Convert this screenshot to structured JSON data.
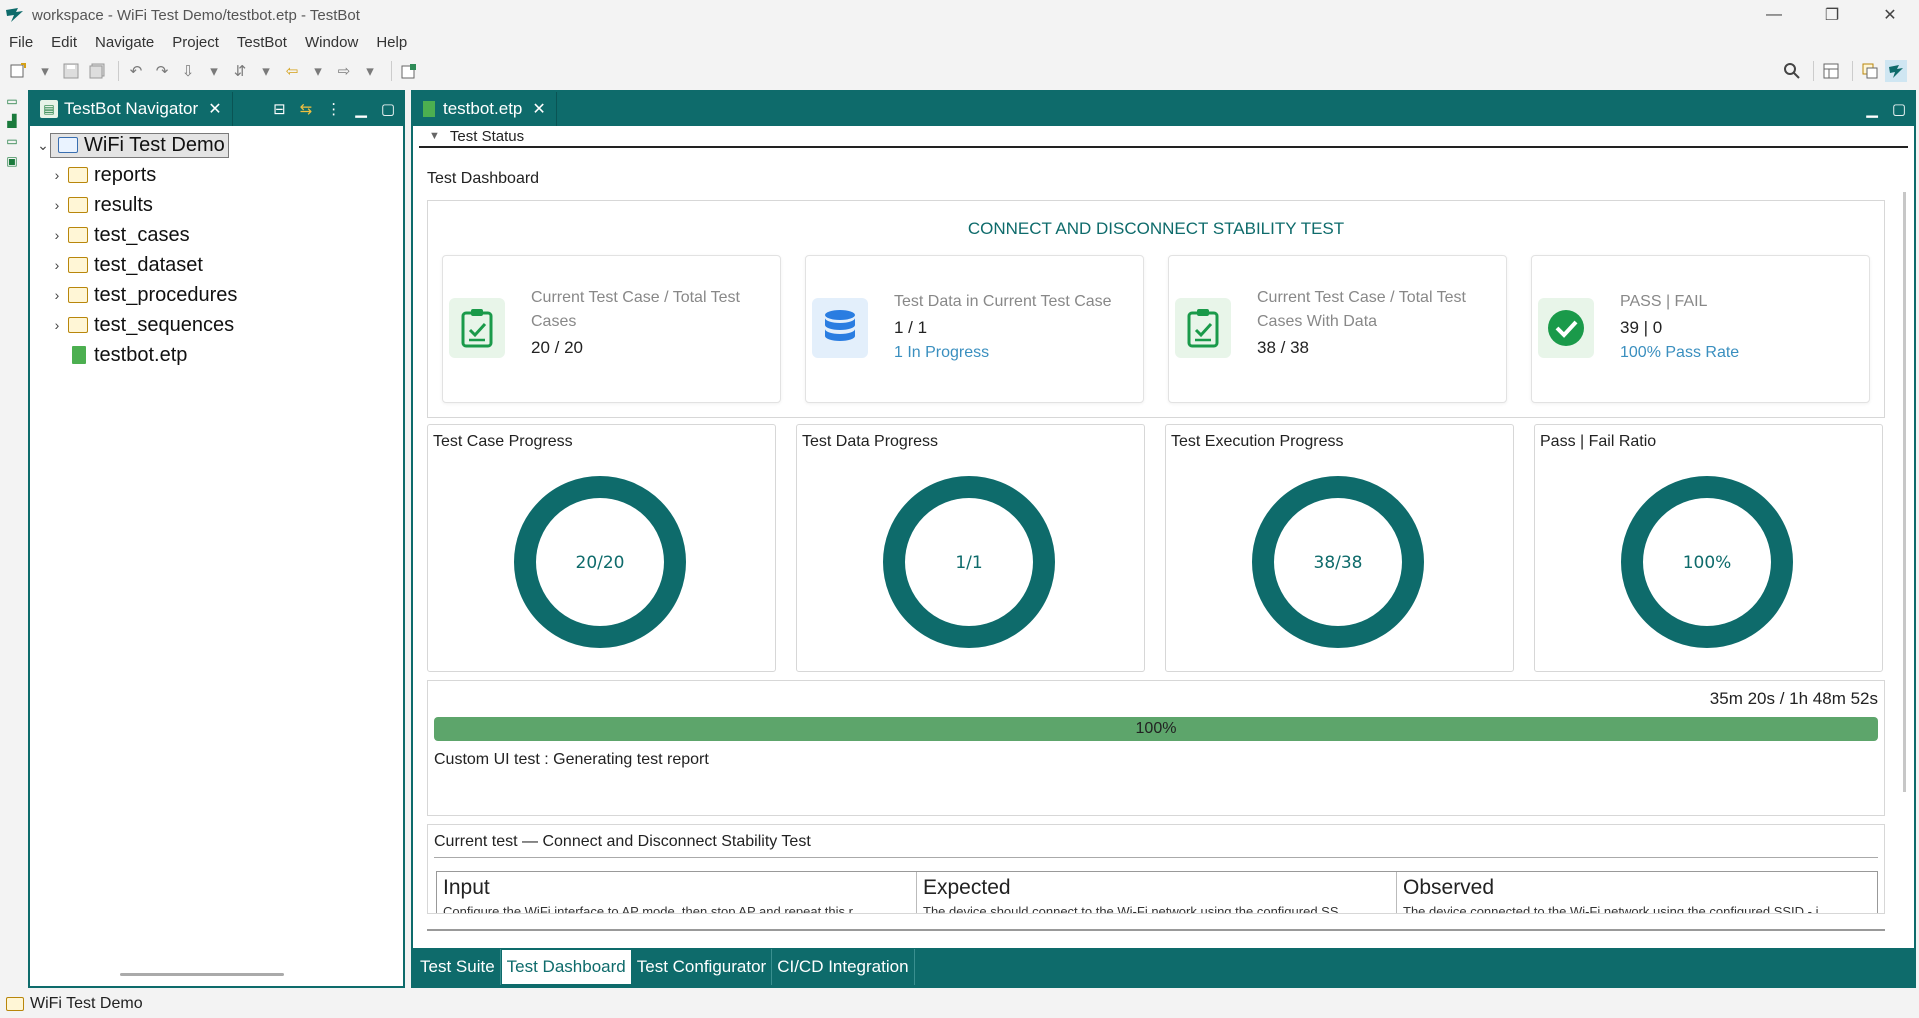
{
  "window": {
    "title": "workspace - WiFi Test Demo/testbot.etp - TestBot",
    "minimize": "—",
    "maximize": "❐",
    "close": "✕"
  },
  "menu": [
    "File",
    "Edit",
    "Navigate",
    "Project",
    "TestBot",
    "Window",
    "Help"
  ],
  "navigator": {
    "tab_label": "TestBot Navigator",
    "root": "WiFi Test Demo",
    "folders": [
      "reports",
      "results",
      "test_cases",
      "test_dataset",
      "test_procedures",
      "test_sequences"
    ],
    "file": "testbot.etp"
  },
  "editor": {
    "tab_label": "testbot.etp",
    "section": "Test Status",
    "dashboard_title": "Test Dashboard",
    "overview_title": "CONNECT AND DISCONNECT STABILITY TEST",
    "cards": [
      {
        "label": "Current Test Case / Total Test Cases",
        "value": "20 / 20",
        "sub": ""
      },
      {
        "label": "Test Data in Current Test Case",
        "value": "1 / 1",
        "sub": "1 In Progress"
      },
      {
        "label": "Current Test Case / Total Test Cases With Data",
        "value": "38 / 38",
        "sub": ""
      },
      {
        "label": "PASS | FAIL",
        "value": "39 | 0",
        "sub": "100% Pass Rate"
      }
    ],
    "gauges": [
      {
        "title": "Test Case Progress",
        "text": "20/20",
        "fraction": 1.0
      },
      {
        "title": "Test Data Progress",
        "text": "1/1",
        "fraction": 1.0
      },
      {
        "title": "Test Execution Progress",
        "text": "38/38",
        "fraction": 1.0
      },
      {
        "title": "Pass | Fail Ratio",
        "text": "100%",
        "fraction": 1.0
      }
    ],
    "progress": {
      "time": "35m 20s / 1h 48m 52s",
      "percent_label": "100%",
      "fraction": 1.0,
      "status": "Custom UI test : Generating test report"
    },
    "current_test": {
      "title": "Current test — Connect and Disconnect Stability Test",
      "columns": [
        {
          "header": "Input",
          "cell": "Configure the WiFi interface to AP mode, then stop AP and repeat this r"
        },
        {
          "header": "Expected",
          "cell": "The device should connect to the Wi-Fi network using the configured SS"
        },
        {
          "header": "Observed",
          "cell": "The device connected to the Wi-Fi network using the configured SSID - i"
        }
      ]
    },
    "bottom_tabs": [
      "Test Suite",
      "Test Dashboard",
      "Test Configurator",
      "CI/CD Integration"
    ],
    "active_tab": "Test Dashboard"
  },
  "statusbar": {
    "text": "WiFi Test Demo"
  },
  "colors": {
    "accent": "#0e6b6b",
    "progress": "#5da56b",
    "link": "#3a8fbf",
    "pass": "#1a9a4a"
  }
}
